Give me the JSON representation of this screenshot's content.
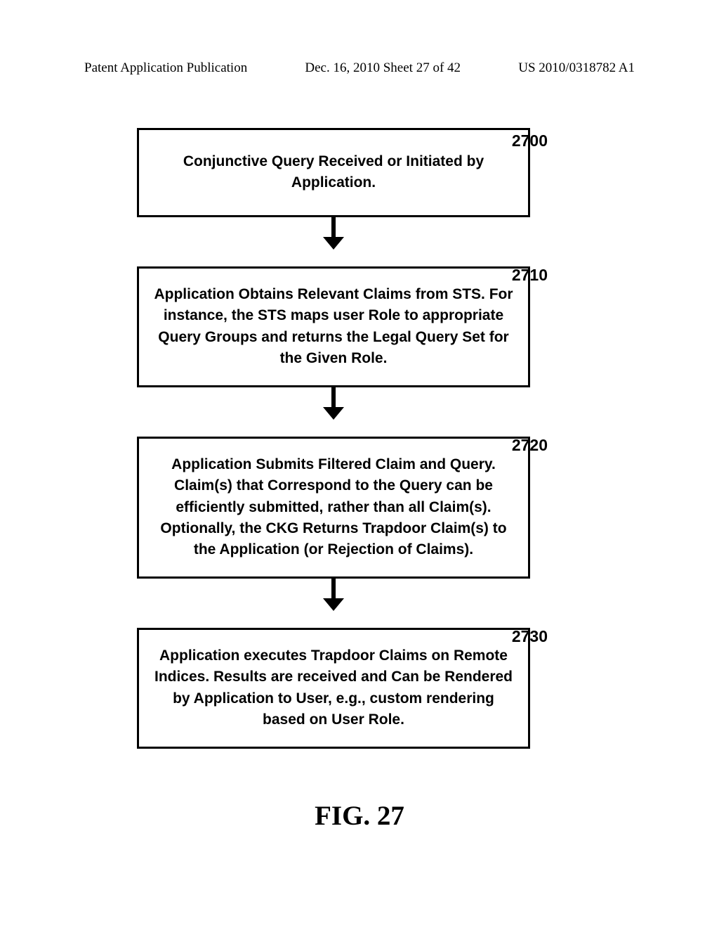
{
  "header": {
    "left": "Patent Application Publication",
    "center": "Dec. 16, 2010  Sheet 27 of 42",
    "right": "US 2010/0318782 A1"
  },
  "steps": [
    {
      "num": "2700",
      "text": "Conjunctive Query Received or Initiated by Application."
    },
    {
      "num": "2710",
      "text": "Application Obtains Relevant Claims from STS. For instance, the STS maps user Role to appropriate Query Groups and returns the Legal Query Set for the Given Role."
    },
    {
      "num": "2720",
      "text": "Application Submits Filtered Claim and Query. Claim(s) that Correspond to the Query can be efficiently submitted, rather than all Claim(s). Optionally, the CKG Returns Trapdoor Claim(s) to the Application (or Rejection of Claims)."
    },
    {
      "num": "2730",
      "text": "Application executes Trapdoor Claims on Remote Indices.  Results are received and Can be Rendered by Application to User, e.g., custom rendering based on User Role."
    }
  ],
  "figure_caption": "FIG. 27"
}
